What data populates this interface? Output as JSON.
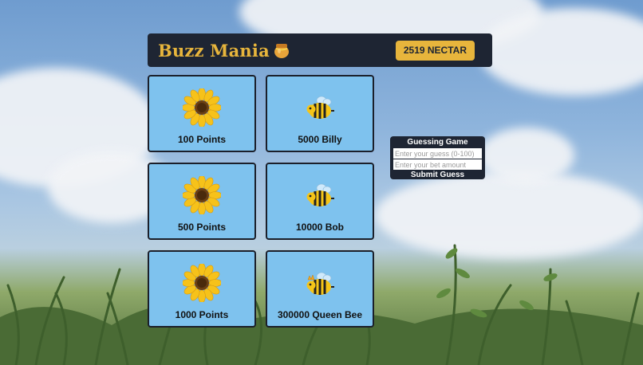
{
  "header": {
    "title": "Buzz Mania",
    "title_icon": "honey-pot-icon",
    "nectar_label": "2519 NECTAR"
  },
  "cards": [
    {
      "label": "100 Points",
      "icon": "sunflower-icon"
    },
    {
      "label": "5000 Billy",
      "icon": "bee-icon"
    },
    {
      "label": "500 Points",
      "icon": "sunflower-icon"
    },
    {
      "label": "10000 Bob",
      "icon": "bee-icon"
    },
    {
      "label": "1000 Points",
      "icon": "sunflower-icon"
    },
    {
      "label": "300000 Queen Bee",
      "icon": "queen-bee-icon"
    }
  ],
  "guessing_game": {
    "title": "Guessing Game",
    "guess_placeholder": "Enter your guess (0-100)",
    "bet_placeholder": "Enter your bet amount",
    "submit_label": "Submit Guess"
  },
  "colors": {
    "header_bg": "#1e2533",
    "accent": "#e7b53c",
    "card_bg": "#7ec2ee"
  }
}
